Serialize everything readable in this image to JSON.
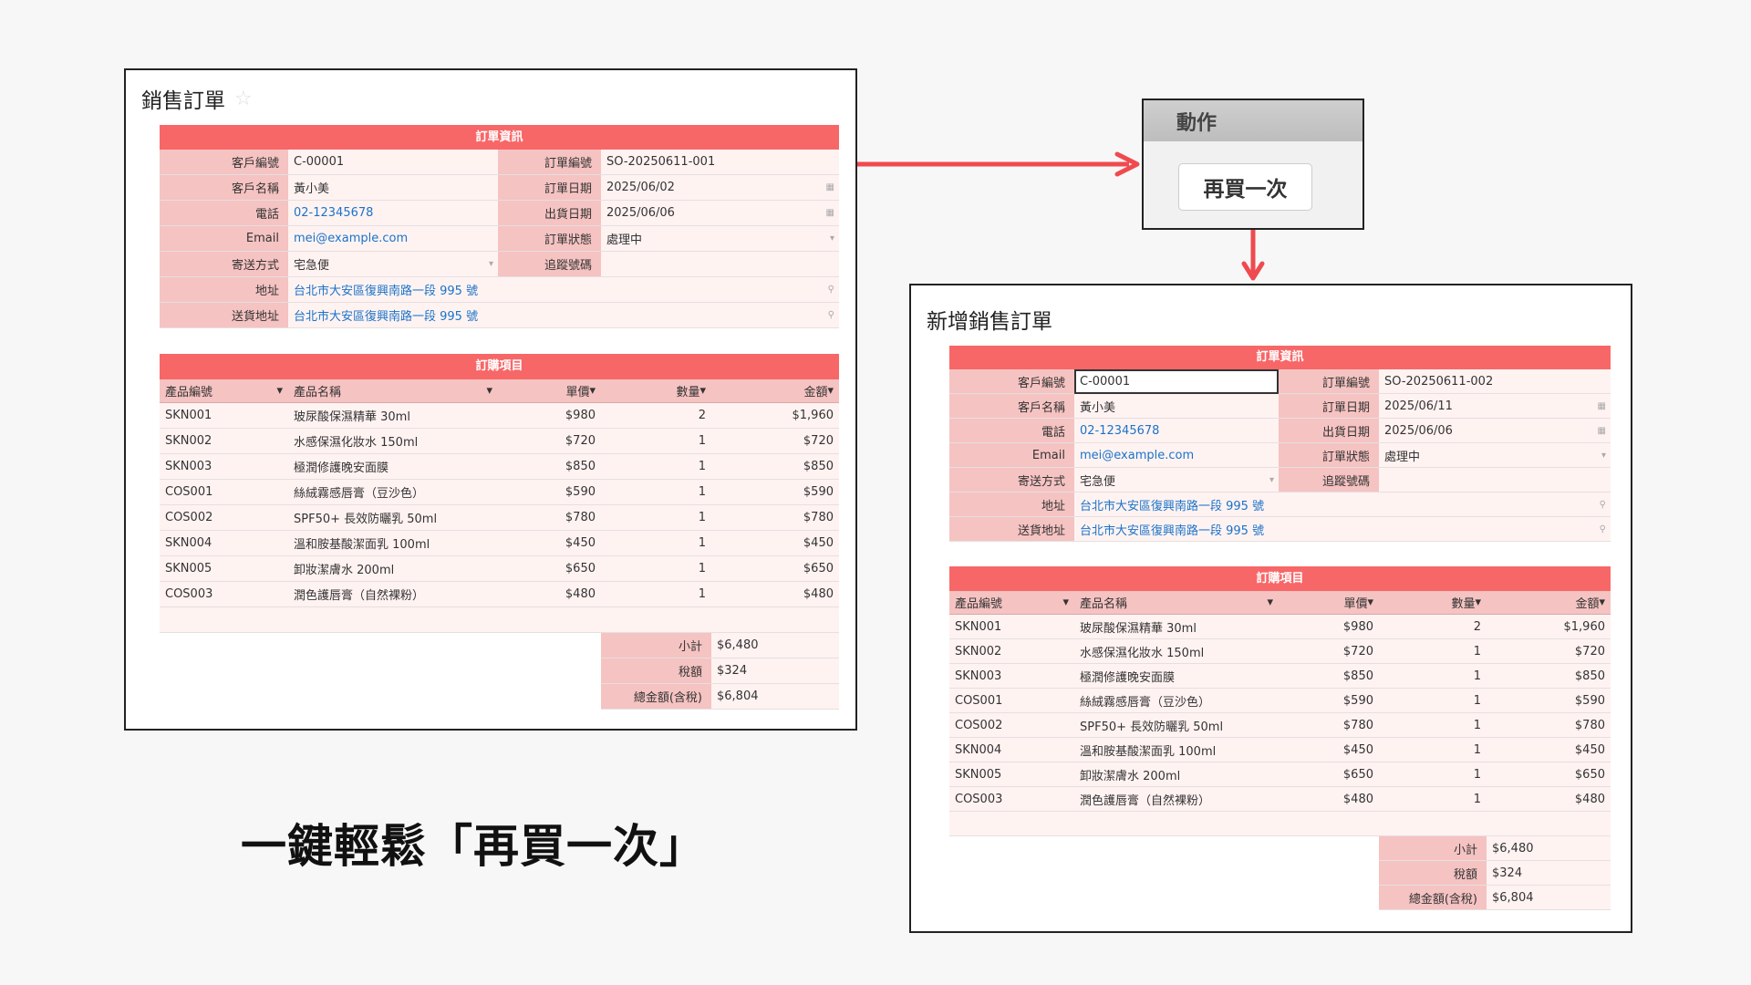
{
  "colors": {
    "accent": "#f76768",
    "label_bg": "#f5c3c2",
    "cell_bg": "#fff3f2",
    "link": "#1a73c8",
    "arrow": "#ef4a4f"
  },
  "left_panel": {
    "title": "銷售訂單",
    "order": {
      "section": "訂單資訊",
      "customer_id_label": "客戶編號",
      "customer_id": "C-00001",
      "order_no_label": "訂單編號",
      "order_no": "SO-20250611-001",
      "customer_name_label": "客戶名稱",
      "customer_name": "黃小美",
      "order_date_label": "訂單日期",
      "order_date": "2025/06/02",
      "phone_label": "電話",
      "phone": "02-12345678",
      "ship_date_label": "出貨日期",
      "ship_date": "2025/06/06",
      "email_label": "Email",
      "email": "mei@example.com",
      "status_label": "訂單狀態",
      "status": "處理中",
      "shipping_label": "寄送方式",
      "shipping": "宅急便",
      "tracking_label": "追蹤號碼",
      "tracking": "",
      "address_label": "地址",
      "address": "台北市大安區復興南路一段 995 號",
      "ship_address_label": "送貨地址",
      "ship_address": "台北市大安區復興南路一段 995 號"
    },
    "items": {
      "section": "訂購項目",
      "headers": [
        "產品編號",
        "產品名稱",
        "單價",
        "數量",
        "金額"
      ],
      "rows": [
        [
          "SKN001",
          "玻尿酸保濕精華 30ml",
          "$980",
          "2",
          "$1,960"
        ],
        [
          "SKN002",
          "水感保濕化妝水 150ml",
          "$720",
          "1",
          "$720"
        ],
        [
          "SKN003",
          "極潤修護晚安面膜",
          "$850",
          "1",
          "$850"
        ],
        [
          "COS001",
          "絲絨霧感唇膏（豆沙色）",
          "$590",
          "1",
          "$590"
        ],
        [
          "COS002",
          "SPF50+ 長效防曬乳 50ml",
          "$780",
          "1",
          "$780"
        ],
        [
          "SKN004",
          "溫和胺基酸潔面乳 100ml",
          "$450",
          "1",
          "$450"
        ],
        [
          "SKN005",
          "卸妝潔膚水 200ml",
          "$650",
          "1",
          "$650"
        ],
        [
          "COS003",
          "潤色護唇膏（自然裸粉）",
          "$480",
          "1",
          "$480"
        ]
      ],
      "subtotal_label": "小計",
      "subtotal": "$6,480",
      "tax_label": "稅額",
      "tax": "$324",
      "total_label": "總金額(含稅)",
      "total": "$6,804"
    }
  },
  "action_panel": {
    "title": "動作",
    "button": "再買一次"
  },
  "right_panel": {
    "title": "新增銷售訂單",
    "order": {
      "section": "訂單資訊",
      "customer_id_label": "客戶編號",
      "customer_id": "C-00001",
      "order_no_label": "訂單編號",
      "order_no": "SO-20250611-002",
      "customer_name_label": "客戶名稱",
      "customer_name": "黃小美",
      "order_date_label": "訂單日期",
      "order_date": "2025/06/11",
      "phone_label": "電話",
      "phone": "02-12345678",
      "ship_date_label": "出貨日期",
      "ship_date": "2025/06/06",
      "email_label": "Email",
      "email": "mei@example.com",
      "status_label": "訂單狀態",
      "status": "處理中",
      "shipping_label": "寄送方式",
      "shipping": "宅急便",
      "tracking_label": "追蹤號碼",
      "tracking": "",
      "address_label": "地址",
      "address": "台北市大安區復興南路一段 995 號",
      "ship_address_label": "送貨地址",
      "ship_address": "台北市大安區復興南路一段 995 號"
    },
    "items": {
      "section": "訂購項目",
      "headers": [
        "產品編號",
        "產品名稱",
        "單價",
        "數量",
        "金額"
      ],
      "rows": [
        [
          "SKN001",
          "玻尿酸保濕精華 30ml",
          "$980",
          "2",
          "$1,960"
        ],
        [
          "SKN002",
          "水感保濕化妝水 150ml",
          "$720",
          "1",
          "$720"
        ],
        [
          "SKN003",
          "極潤修護晚安面膜",
          "$850",
          "1",
          "$850"
        ],
        [
          "COS001",
          "絲絨霧感唇膏（豆沙色）",
          "$590",
          "1",
          "$590"
        ],
        [
          "COS002",
          "SPF50+ 長效防曬乳 50ml",
          "$780",
          "1",
          "$780"
        ],
        [
          "SKN004",
          "溫和胺基酸潔面乳 100ml",
          "$450",
          "1",
          "$450"
        ],
        [
          "SKN005",
          "卸妝潔膚水 200ml",
          "$650",
          "1",
          "$650"
        ],
        [
          "COS003",
          "潤色護唇膏（自然裸粉）",
          "$480",
          "1",
          "$480"
        ]
      ],
      "subtotal_label": "小計",
      "subtotal": "$6,480",
      "tax_label": "稅額",
      "tax": "$324",
      "total_label": "總金額(含稅)",
      "total": "$6,804"
    }
  },
  "caption": "一鍵輕鬆「再買一次」"
}
